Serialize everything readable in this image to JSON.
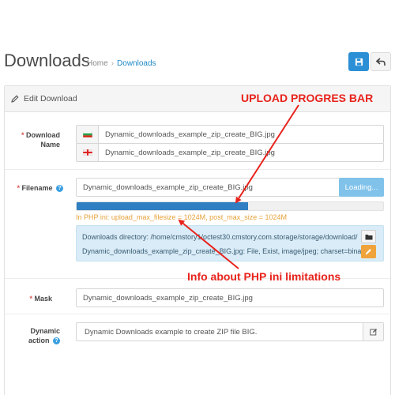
{
  "header": {
    "title": "Downloads",
    "breadcrumb": {
      "home": "Home",
      "separator": "›",
      "current": "Downloads"
    }
  },
  "toolbar": {
    "save_icon": "floppy-disk-icon",
    "back_icon": "back-arrow-icon"
  },
  "panel": {
    "heading_icon": "pencil-icon",
    "heading": "Edit Download"
  },
  "form": {
    "download_name": {
      "label_line1": "Download",
      "label_line2": "Name",
      "required": "*",
      "values": [
        {
          "flag": "bulgarian-flag-icon",
          "value": "Dynamic_downloads_example_zip_create_BIG.jpg"
        },
        {
          "flag": "english-flag-icon",
          "value": "Dynamic_downloads_example_zip_create_BIG.jpg"
        }
      ]
    },
    "filename": {
      "label": "Filename",
      "required": "*",
      "help": "?",
      "value": "Dynamic_downloads_example_zip_create_BIG.jpg",
      "loading_label": "Loading...",
      "progress": 0.56,
      "php_info": "In PHP ini: upload_max_filesize = 1024M, post_max_size = 1024M",
      "info_directory": "Downloads directory: /home/cmstory1/octest30.cmstory.com.storage/storage/download/",
      "info_file": "Dynamic_downloads_example_zip_create_BIG.jpg: File, Exist, image/jpeg; charset=binary"
    },
    "mask": {
      "label": "Mask",
      "required": "*",
      "value": "Dynamic_downloads_example_zip_create_BIG.jpg"
    },
    "dynamic_action": {
      "label_line1": "Dynamic",
      "label_line2": "action",
      "help": "?",
      "value": "Dynamic Downloads example to create ZIP file BIG."
    }
  },
  "annotations": {
    "progress_label": "UPLOAD PROGRES BAR",
    "php_label": "Info about PHP ini limitations",
    "color": "#e8231c"
  },
  "colors": {
    "accent": "#2b8fd6",
    "progress": "#2f7fc2",
    "warning": "#e6a138",
    "info_bg": "#d9ecf7"
  }
}
